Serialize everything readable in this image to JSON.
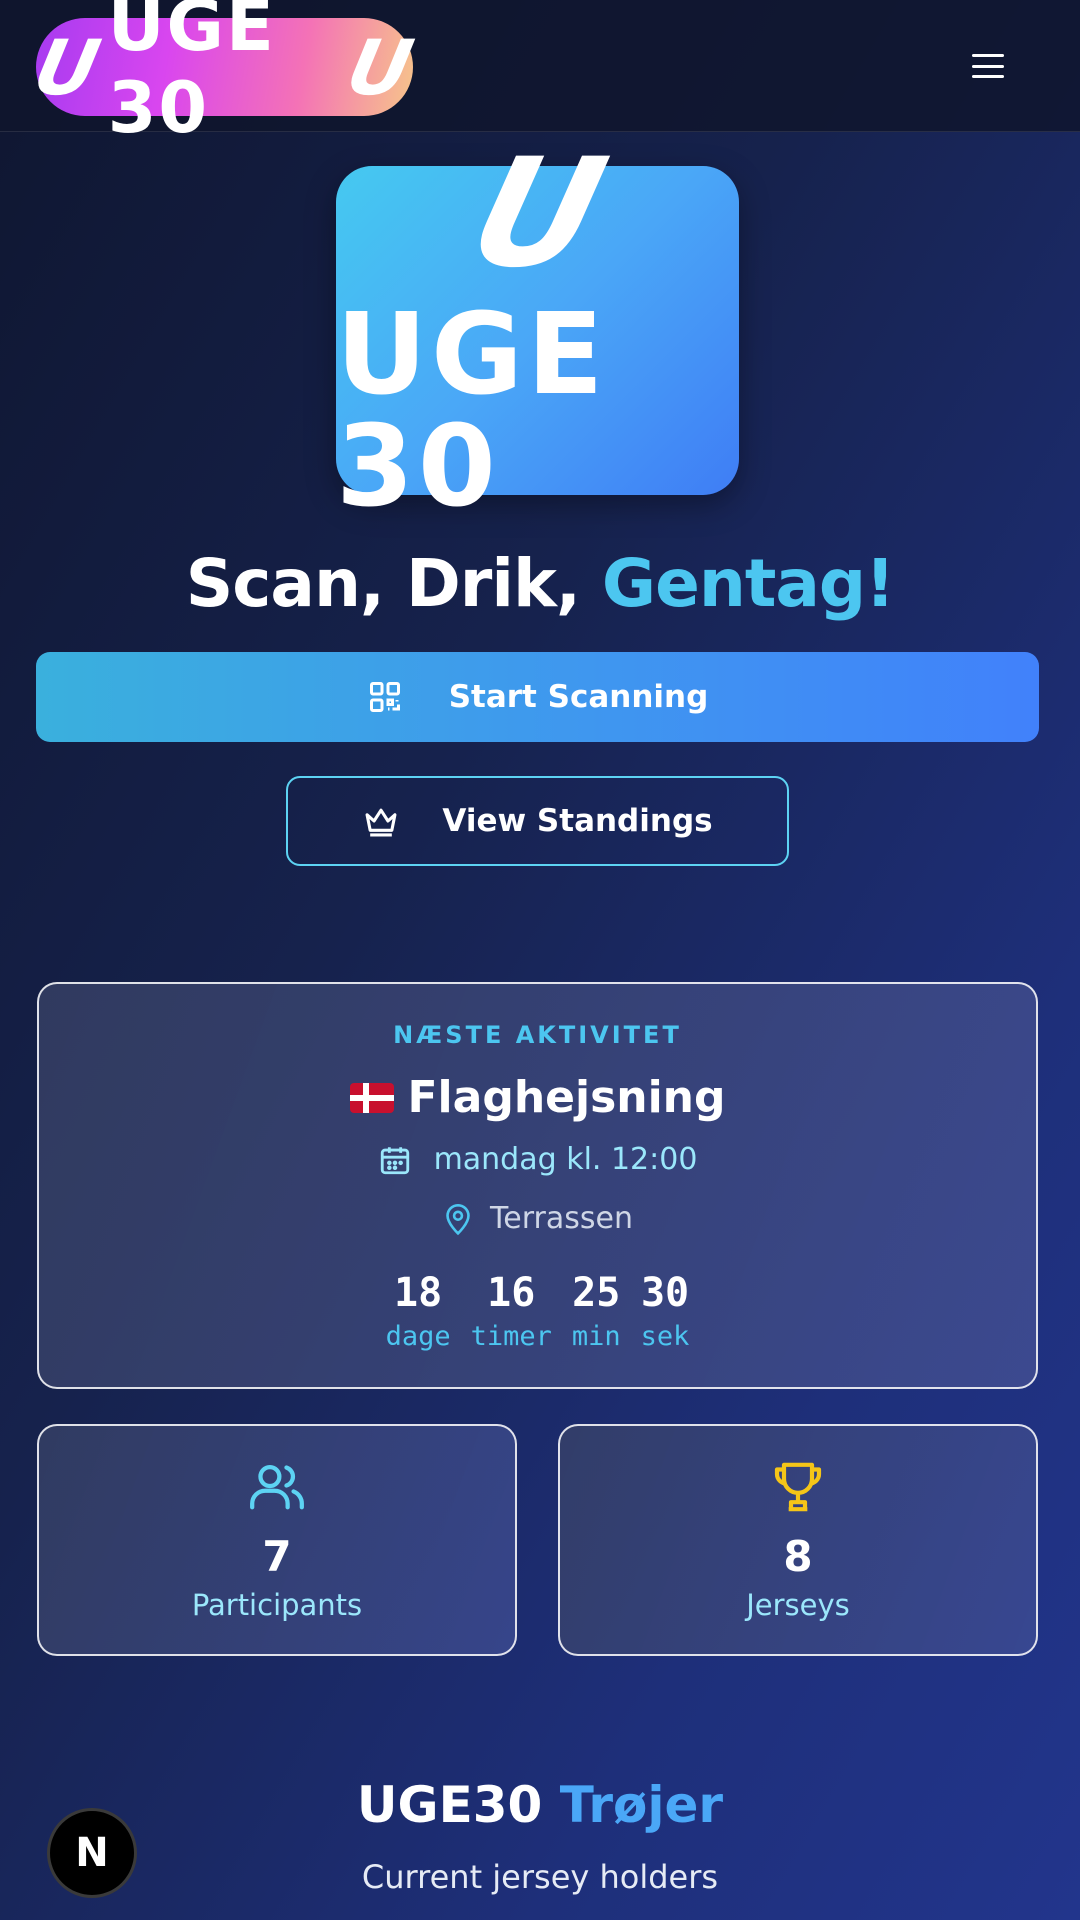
{
  "header": {
    "logo_text": "UGE 30",
    "logo_mark": "U",
    "menu_icon": "hamburger-menu-icon"
  },
  "hero": {
    "logo_mark": "U",
    "logo_text": "UGE 30",
    "headline_part1": "Scan, Drik, ",
    "headline_accent": "Gentag!"
  },
  "actions": {
    "start_label": "Start Scanning",
    "start_icon": "qr-code-icon",
    "standings_label": "View Standings",
    "standings_icon": "crown-icon"
  },
  "activity": {
    "section_label": "NÆSTE AKTIVITET",
    "title": "Flaghejsning",
    "flag_icon": "danish-flag-icon",
    "time": "mandag kl. 12:00",
    "location": "Terrassen",
    "countdown": [
      {
        "value": "18",
        "label": "dage"
      },
      {
        "value": "16",
        "label": "timer"
      },
      {
        "value": "25",
        "label": "min"
      },
      {
        "value": "30",
        "label": "sek"
      }
    ]
  },
  "stats": {
    "participants": {
      "value": "7",
      "label": "Participants",
      "icon": "users-icon"
    },
    "jerseys": {
      "value": "8",
      "label": "Jerseys",
      "icon": "trophy-icon"
    }
  },
  "jerseys_section": {
    "title_part1": "UGE30 ",
    "title_accent": "Trøjer",
    "subtitle": "Current jersey holders"
  },
  "dev_badge": {
    "label": "N"
  },
  "colors": {
    "accent_cyan": "#4cc6f0",
    "accent_blue": "#4181fb",
    "trophy_gold": "#f5c518"
  }
}
